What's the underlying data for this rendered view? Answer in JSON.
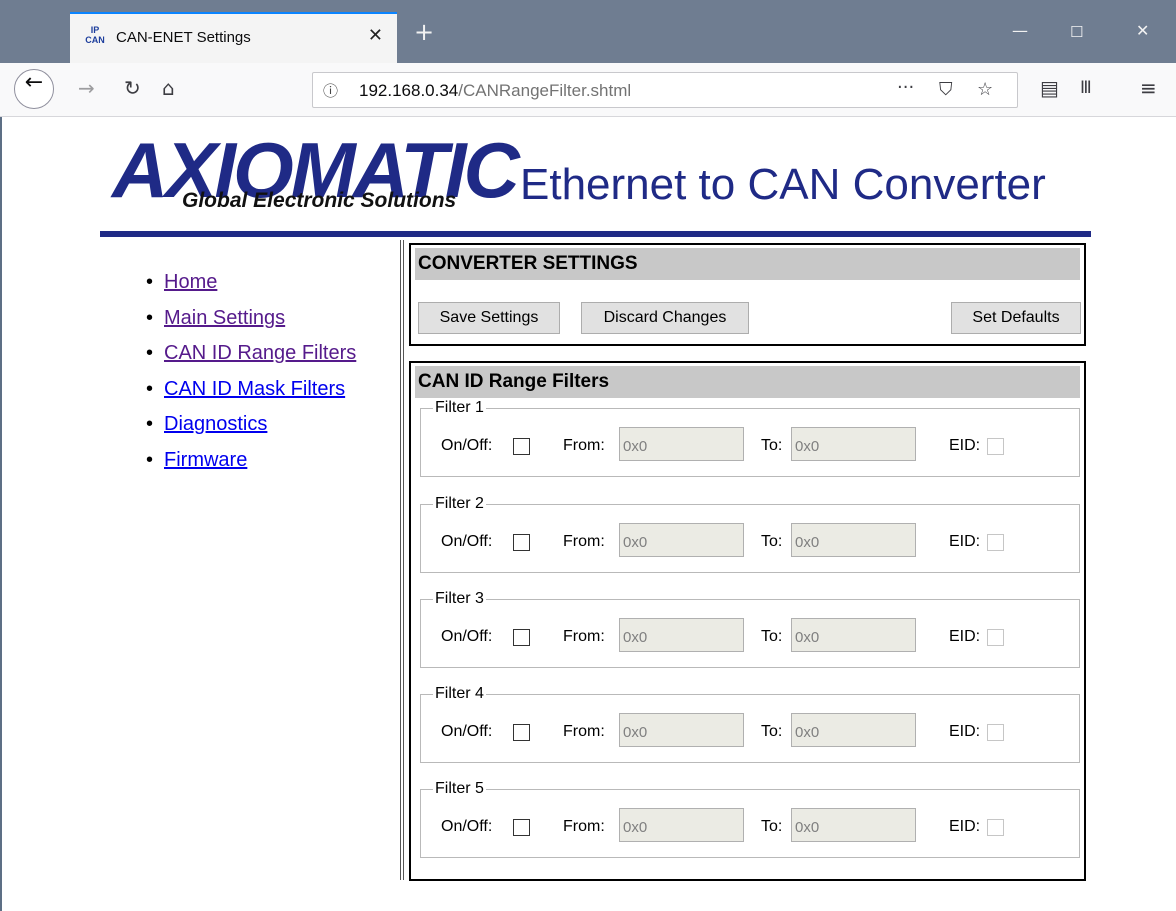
{
  "browser": {
    "tab_title": "CAN-ENET Settings",
    "favicon_text_top": "IP",
    "favicon_text_bottom": "CAN",
    "url_host": "192.168.0.34",
    "url_path": "/CANRangeFilter.shtml",
    "icons": [
      "back-icon",
      "forward-icon",
      "reload-icon",
      "home-icon",
      "info-icon",
      "more-icon",
      "pocket-icon",
      "bookmark-star-icon",
      "sidebar-icon",
      "library-icon",
      "menu-icon",
      "minimize-icon",
      "maximize-icon",
      "close-icon"
    ]
  },
  "header": {
    "logo_text": "AXIOMATIC",
    "logo_tagline": "Global Electronic Solutions",
    "title": "Ethernet to CAN Converter"
  },
  "nav": {
    "items": [
      {
        "label": "Home",
        "visited": true
      },
      {
        "label": "Main Settings",
        "visited": true
      },
      {
        "label": "CAN ID Range Filters",
        "visited": true
      },
      {
        "label": "CAN ID Mask Filters",
        "visited": false
      },
      {
        "label": "Diagnostics",
        "visited": false
      },
      {
        "label": "Firmware",
        "visited": false
      }
    ]
  },
  "converter": {
    "heading": "CONVERTER SETTINGS",
    "save_label": "Save Settings",
    "discard_label": "Discard Changes",
    "defaults_label": "Set Defaults"
  },
  "range_filters": {
    "heading": "CAN ID Range Filters",
    "onoff_label": "On/Off:",
    "from_label": "From:",
    "to_label": "To:",
    "eid_label": "EID:",
    "filters": [
      {
        "legend": "Filter 1",
        "from": "0x0",
        "to": "0x0",
        "on": false,
        "eid": false
      },
      {
        "legend": "Filter 2",
        "from": "0x0",
        "to": "0x0",
        "on": false,
        "eid": false
      },
      {
        "legend": "Filter 3",
        "from": "0x0",
        "to": "0x0",
        "on": false,
        "eid": false
      },
      {
        "legend": "Filter 4",
        "from": "0x0",
        "to": "0x0",
        "on": false,
        "eid": false
      },
      {
        "legend": "Filter 5",
        "from": "0x0",
        "to": "0x0",
        "on": false,
        "eid": false
      }
    ]
  },
  "colors": {
    "brand_blue": "#1f2a86",
    "link": "#0000ee",
    "link_visited": "#551a8b",
    "panel_header": "#c8c8c8",
    "titlebar": "#6f7d91"
  }
}
